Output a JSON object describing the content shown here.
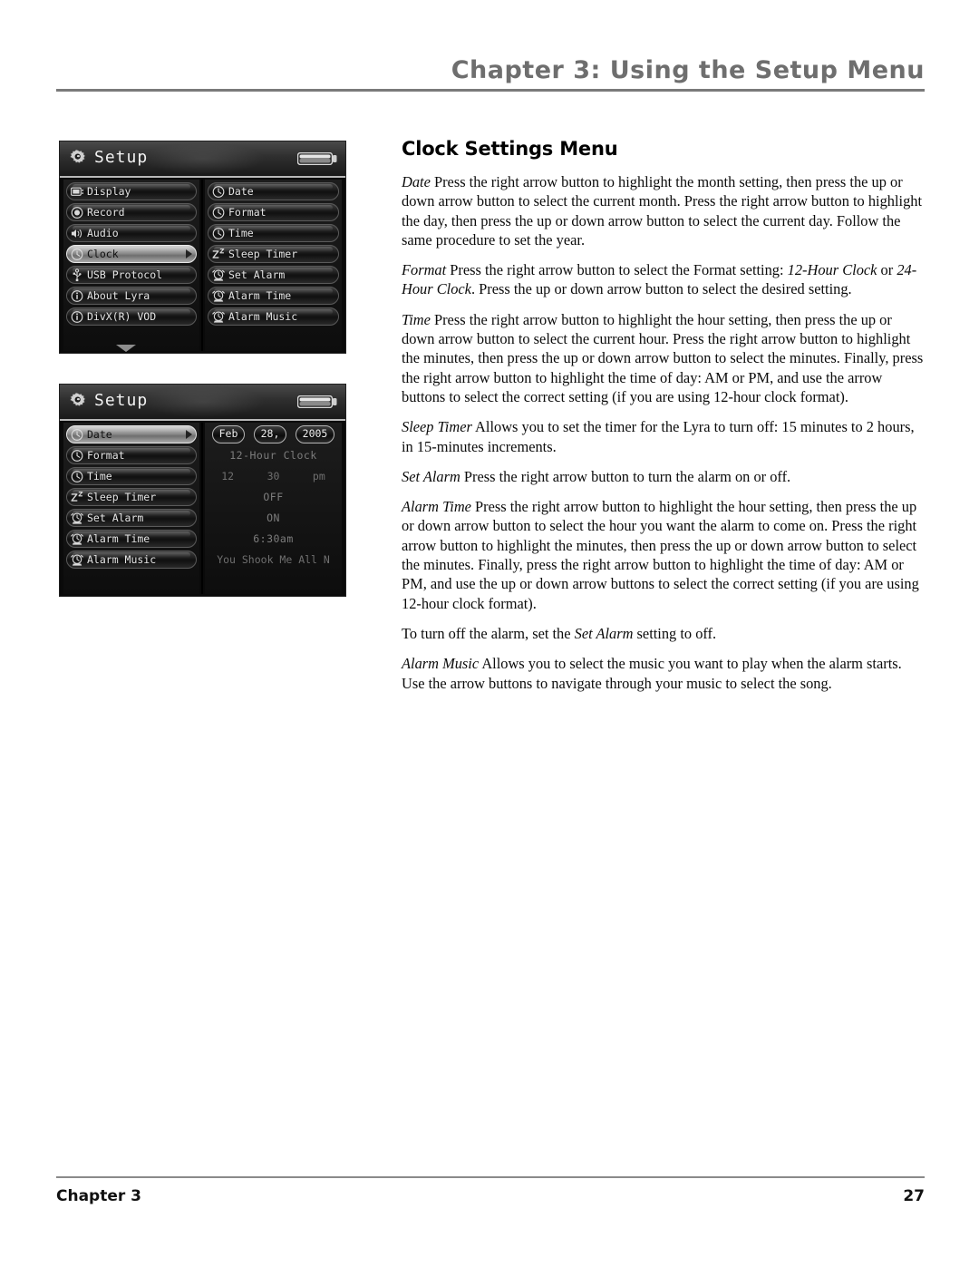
{
  "header": {
    "chapter_title": "Chapter 3: Using the Setup Menu"
  },
  "footer": {
    "chapter_label": "Chapter 3",
    "page_number": "27"
  },
  "main": {
    "section_title": "Clock Settings Menu",
    "paragraphs": [
      {
        "term": "Date",
        "body": " Press the right arrow button to highlight the month setting, then press the up or down arrow button to select the current month. Press the right arrow button to highlight the day, then press the up or down arrow button to select the current day. Follow the same procedure to set the year."
      },
      {
        "term": "Format",
        "body": " Press the right arrow button to select the Format setting: ",
        "em1": "12-Hour Clock",
        "mid": " or ",
        "em2": "24-Hour Clock",
        "tail": ". Press the up or down arrow button to select the desired setting."
      },
      {
        "term": "Time",
        "body": " Press the right arrow button to highlight the hour setting, then press the up or down arrow button to select the current hour. Press the right arrow button to highlight the minutes, then press the up or down arrow button to select the minutes. Finally, press the right arrow button to highlight the time of day: AM or PM, and use the arrow buttons to select the correct setting (if you are using 12-hour clock format)."
      },
      {
        "term": "Sleep Timer",
        "body": " Allows you to set the timer for the Lyra to turn off: 15 minutes to 2 hours, in 15-minutes increments."
      },
      {
        "term": "Set Alarm",
        "body": " Press the right arrow button to turn the alarm on or off."
      },
      {
        "term": "Alarm Time",
        "body": " Press the right arrow button to highlight the hour setting, then press the up or down arrow button to select the hour you want the alarm to come on. Press the right arrow button to highlight the minutes, then press the up or down arrow button to select the minutes. Finally, press the right arrow button to highlight the time of day: AM or PM, and use the up or down arrow buttons to select the correct setting (if you are using 12-hour clock format)."
      },
      {
        "term": "",
        "pre": "To turn off the alarm, set the ",
        "em1": "Set Alarm",
        "tail": " setting to off."
      },
      {
        "term": "Alarm Music",
        "body": " Allows you to select the music you want to play when the alarm starts. Use the arrow buttons to navigate through your music to select the song."
      }
    ]
  },
  "screenshot1": {
    "title": "Setup",
    "left_items": [
      {
        "label": "Display",
        "icon": "display-icon",
        "selected": false
      },
      {
        "label": "Record",
        "icon": "record-icon",
        "selected": false
      },
      {
        "label": "Audio",
        "icon": "speaker-icon",
        "selected": false
      },
      {
        "label": "Clock",
        "icon": "clock-icon",
        "selected": true
      },
      {
        "label": "USB Protocol",
        "icon": "usb-icon",
        "selected": false
      },
      {
        "label": "About Lyra",
        "icon": "info-icon",
        "selected": false
      },
      {
        "label": "DivX(R) VOD",
        "icon": "info-icon",
        "selected": false
      }
    ],
    "right_items": [
      {
        "label": "Date",
        "icon": "clock-icon"
      },
      {
        "label": "Format",
        "icon": "clock-icon"
      },
      {
        "label": "Time",
        "icon": "clock-icon"
      },
      {
        "label": "Sleep Timer",
        "icon": "sleep-timer-icon"
      },
      {
        "label": "Set Alarm",
        "icon": "alarm-clock-icon"
      },
      {
        "label": "Alarm Time",
        "icon": "alarm-clock-icon"
      },
      {
        "label": "Alarm Music",
        "icon": "alarm-clock-icon"
      }
    ]
  },
  "screenshot2": {
    "title": "Setup",
    "left_items": [
      {
        "label": "Date",
        "icon": "clock-icon",
        "selected": true
      },
      {
        "label": "Format",
        "icon": "clock-icon",
        "selected": false
      },
      {
        "label": "Time",
        "icon": "clock-icon",
        "selected": false
      },
      {
        "label": "Sleep Timer",
        "icon": "sleep-timer-icon",
        "selected": false
      },
      {
        "label": "Set Alarm",
        "icon": "alarm-clock-icon",
        "selected": false
      },
      {
        "label": "Alarm Time",
        "icon": "alarm-clock-icon",
        "selected": false
      },
      {
        "label": "Alarm Music",
        "icon": "alarm-clock-icon",
        "selected": false
      }
    ],
    "values": {
      "date_month": "Feb",
      "date_day": "28,",
      "date_year": "2005",
      "format": "12-Hour Clock",
      "time_hour": "12",
      "time_minute": "30",
      "time_meridiem": "pm",
      "sleep_timer": "OFF",
      "set_alarm": "ON",
      "alarm_time": "6:30am",
      "alarm_music": "You Shook Me All N"
    }
  },
  "colors": {
    "header_gray": "#6e6e6e",
    "rule_gray": "#7a7a7a",
    "device_black": "#0a0a0a",
    "pill_border": "#5a5a5a",
    "selected_pill": "#a8a8a8",
    "value_text": "#7d7d7d"
  }
}
